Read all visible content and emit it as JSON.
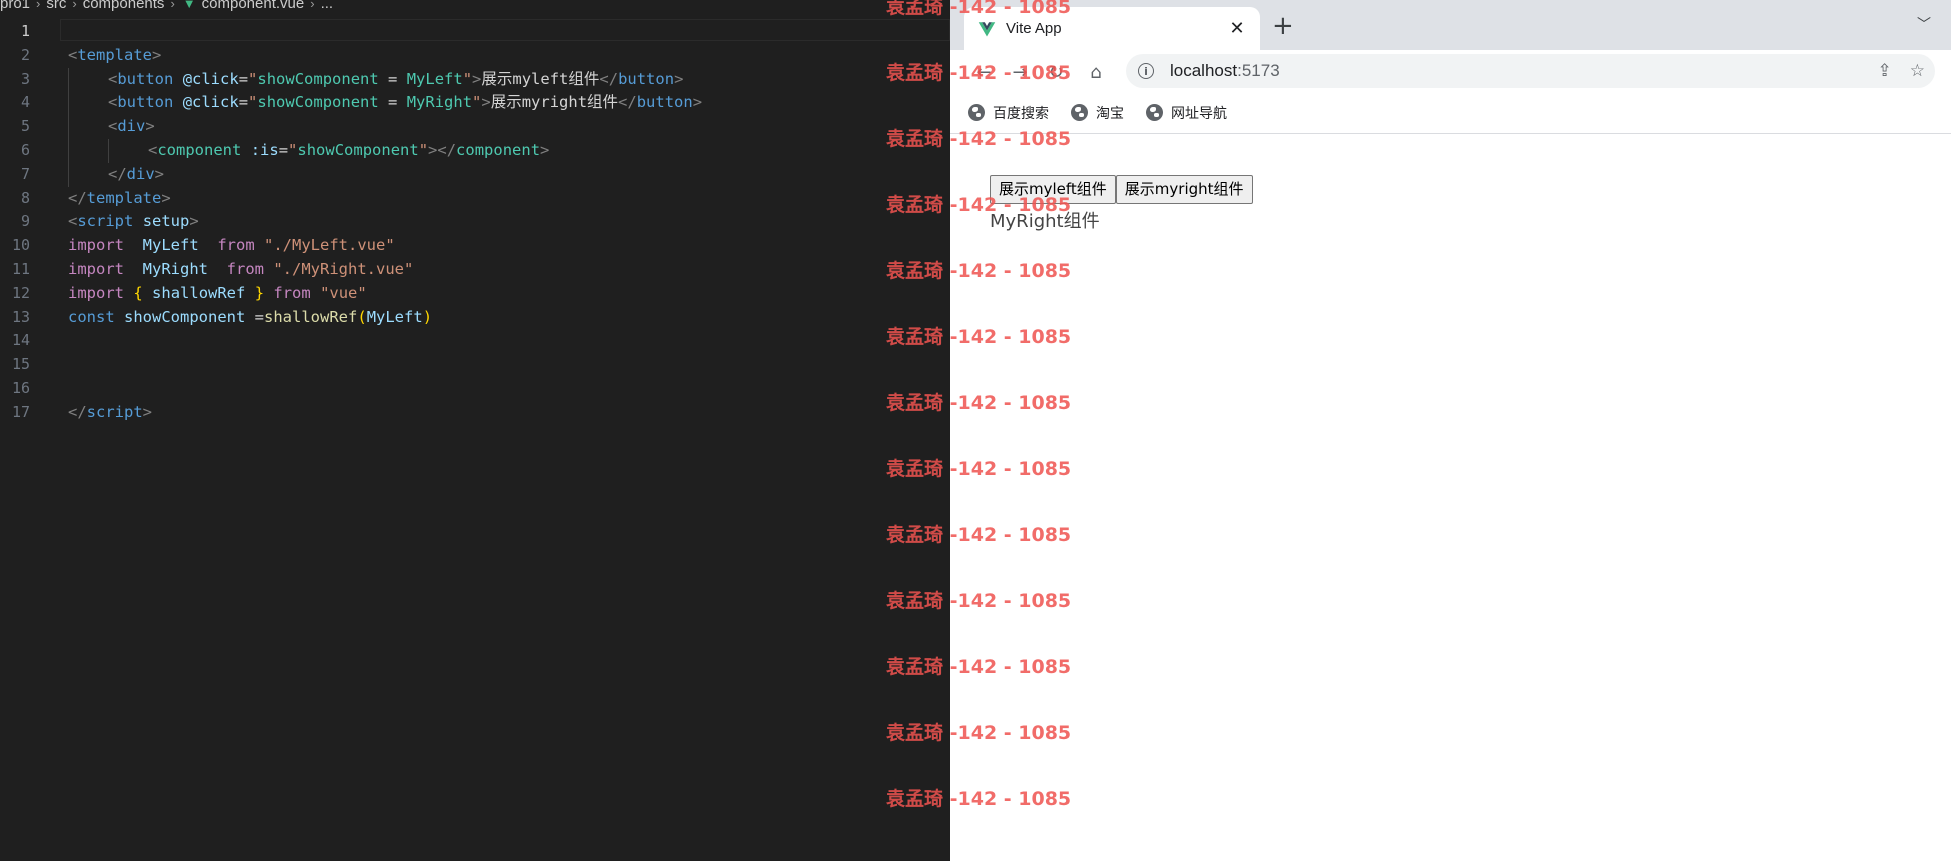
{
  "editor": {
    "breadcrumb": [
      "pro1",
      "src",
      "components",
      "component.vue",
      "..."
    ],
    "current_line": 1,
    "lines": [
      {
        "n": "1",
        "segments": []
      },
      {
        "n": "2",
        "segments": [
          {
            "c": "p",
            "t": "<"
          },
          {
            "c": "t",
            "t": "template"
          },
          {
            "c": "p",
            "t": ">"
          }
        ]
      },
      {
        "n": "3",
        "indent": 1,
        "segments": [
          {
            "c": "p",
            "t": "<"
          },
          {
            "c": "t",
            "t": "button"
          },
          {
            "c": "txt",
            "t": " "
          },
          {
            "c": "a",
            "t": "@click"
          },
          {
            "c": "txt",
            "t": "="
          },
          {
            "c": "s",
            "t": "\""
          },
          {
            "c": "s2",
            "t": "showComponent"
          },
          {
            "c": "txt",
            "t": " = "
          },
          {
            "c": "s2",
            "t": "MyLeft"
          },
          {
            "c": "s",
            "t": "\""
          },
          {
            "c": "p",
            "t": ">"
          },
          {
            "c": "txt",
            "t": "展示myleft组件"
          },
          {
            "c": "p",
            "t": "</"
          },
          {
            "c": "t",
            "t": "button"
          },
          {
            "c": "p",
            "t": ">"
          }
        ]
      },
      {
        "n": "4",
        "indent": 1,
        "segments": [
          {
            "c": "p",
            "t": "<"
          },
          {
            "c": "t",
            "t": "button"
          },
          {
            "c": "txt",
            "t": " "
          },
          {
            "c": "a",
            "t": "@click"
          },
          {
            "c": "txt",
            "t": "="
          },
          {
            "c": "s",
            "t": "\""
          },
          {
            "c": "s2",
            "t": "showComponent"
          },
          {
            "c": "txt",
            "t": " = "
          },
          {
            "c": "s2",
            "t": "MyRight"
          },
          {
            "c": "s",
            "t": "\""
          },
          {
            "c": "p",
            "t": ">"
          },
          {
            "c": "txt",
            "t": "展示myright组件"
          },
          {
            "c": "p",
            "t": "</"
          },
          {
            "c": "t",
            "t": "button"
          },
          {
            "c": "p",
            "t": ">"
          }
        ]
      },
      {
        "n": "5",
        "indent": 1,
        "segments": [
          {
            "c": "p",
            "t": "<"
          },
          {
            "c": "t",
            "t": "div"
          },
          {
            "c": "p",
            "t": ">"
          }
        ]
      },
      {
        "n": "6",
        "indent": 2,
        "segments": [
          {
            "c": "p",
            "t": "<"
          },
          {
            "c": "s2",
            "t": "component"
          },
          {
            "c": "txt",
            "t": " "
          },
          {
            "c": "a",
            "t": ":is"
          },
          {
            "c": "txt",
            "t": "="
          },
          {
            "c": "s",
            "t": "\""
          },
          {
            "c": "s2",
            "t": "showComponent"
          },
          {
            "c": "s",
            "t": "\""
          },
          {
            "c": "p",
            "t": "></"
          },
          {
            "c": "s2",
            "t": "component"
          },
          {
            "c": "p",
            "t": ">"
          }
        ]
      },
      {
        "n": "7",
        "indent": 1,
        "segments": [
          {
            "c": "p",
            "t": "</"
          },
          {
            "c": "t",
            "t": "div"
          },
          {
            "c": "p",
            "t": ">"
          }
        ]
      },
      {
        "n": "8",
        "segments": [
          {
            "c": "p",
            "t": "</"
          },
          {
            "c": "t",
            "t": "template"
          },
          {
            "c": "p",
            "t": ">"
          }
        ]
      },
      {
        "n": "9",
        "segments": [
          {
            "c": "p",
            "t": "<"
          },
          {
            "c": "t",
            "t": "script"
          },
          {
            "c": "txt",
            "t": " "
          },
          {
            "c": "a",
            "t": "setup"
          },
          {
            "c": "p",
            "t": ">"
          }
        ]
      },
      {
        "n": "10",
        "segments": [
          {
            "c": "k",
            "t": "import"
          },
          {
            "c": "txt",
            "t": "  "
          },
          {
            "c": "v",
            "t": "MyLeft"
          },
          {
            "c": "txt",
            "t": "  "
          },
          {
            "c": "k",
            "t": "from"
          },
          {
            "c": "txt",
            "t": " "
          },
          {
            "c": "s",
            "t": "\"./MyLeft.vue\""
          }
        ]
      },
      {
        "n": "11",
        "segments": [
          {
            "c": "k",
            "t": "import"
          },
          {
            "c": "txt",
            "t": "  "
          },
          {
            "c": "v",
            "t": "MyRight"
          },
          {
            "c": "txt",
            "t": "  "
          },
          {
            "c": "k",
            "t": "from"
          },
          {
            "c": "txt",
            "t": " "
          },
          {
            "c": "s",
            "t": "\"./MyRight.vue\""
          }
        ]
      },
      {
        "n": "12",
        "segments": [
          {
            "c": "k",
            "t": "import"
          },
          {
            "c": "txt",
            "t": " "
          },
          {
            "c": "br",
            "t": "{"
          },
          {
            "c": "txt",
            "t": " "
          },
          {
            "c": "v",
            "t": "shallowRef"
          },
          {
            "c": "txt",
            "t": " "
          },
          {
            "c": "br",
            "t": "}"
          },
          {
            "c": "txt",
            "t": " "
          },
          {
            "c": "k",
            "t": "from"
          },
          {
            "c": "txt",
            "t": " "
          },
          {
            "c": "s",
            "t": "\"vue\""
          }
        ]
      },
      {
        "n": "13",
        "segments": [
          {
            "c": "kw",
            "t": "const"
          },
          {
            "c": "txt",
            "t": " "
          },
          {
            "c": "v",
            "t": "showComponent"
          },
          {
            "c": "txt",
            "t": " ="
          },
          {
            "c": "fn",
            "t": "shallowRef"
          },
          {
            "c": "br",
            "t": "("
          },
          {
            "c": "v",
            "t": "MyLeft"
          },
          {
            "c": "br",
            "t": ")"
          }
        ]
      },
      {
        "n": "14",
        "segments": []
      },
      {
        "n": "15",
        "segments": []
      },
      {
        "n": "16",
        "segments": []
      },
      {
        "n": "17",
        "segments": [
          {
            "c": "p",
            "t": "</"
          },
          {
            "c": "t",
            "t": "script"
          },
          {
            "c": "p",
            "t": ">"
          }
        ]
      }
    ]
  },
  "watermark": {
    "text": "袁孟琦 -142 - 1085",
    "color": "#ef5350"
  },
  "browser": {
    "tab_title": "Vite App",
    "tab_favicon": "vue-logo-icon",
    "new_tab_label": "+",
    "url_host": "localhost",
    "url_port": ":5173",
    "bookmarks": [
      {
        "label": "百度搜索",
        "icon": "globe-icon"
      },
      {
        "label": "淘宝",
        "icon": "globe-icon"
      },
      {
        "label": "网址导航",
        "icon": "globe-icon"
      }
    ],
    "page": {
      "buttons": [
        "展示myleft组件",
        "展示myright组件"
      ],
      "output": "MyRight组件"
    }
  }
}
